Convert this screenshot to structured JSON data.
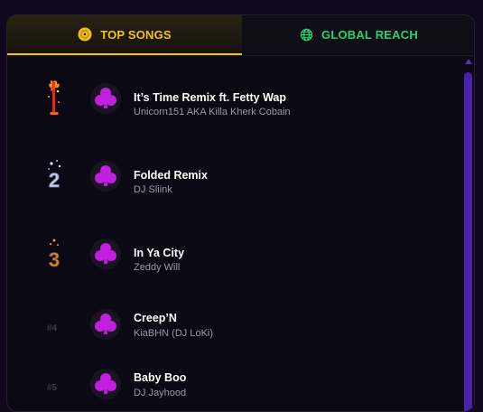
{
  "tabs": {
    "top_songs": "TOP SONGS",
    "global_reach": "GLOBAL REACH"
  },
  "songs": [
    {
      "rank": "1",
      "title": "It’s Time Remix ft. Fetty Wap",
      "artist": "Unicorn151 AKA Killa Kherk Cobain",
      "rank_style": "fire-red"
    },
    {
      "rank": "2",
      "title": "Folded Remix",
      "artist": "DJ Sliink",
      "rank_style": "ice-silver"
    },
    {
      "rank": "3",
      "title": "In Ya City",
      "artist": "Zeddy Will",
      "rank_style": "fire-bronze"
    },
    {
      "rank": "#4",
      "title": "Creep’N",
      "artist": "KiaBHN (DJ LoKi)",
      "rank_style": "plain"
    },
    {
      "rank": "#5",
      "title": "Baby Boo",
      "artist": "DJ Jayhood",
      "rank_style": "plain"
    }
  ],
  "colors": {
    "accent_gold": "#f5c21a",
    "accent_green": "#22d56e",
    "club_magenta": "#c21fe0",
    "scroll_purple": "#4a1fb0"
  },
  "icons": {
    "top_songs_tab": "vinyl-record-icon",
    "global_reach_tab": "globe-icon",
    "song_art": "club-suit-icon"
  }
}
